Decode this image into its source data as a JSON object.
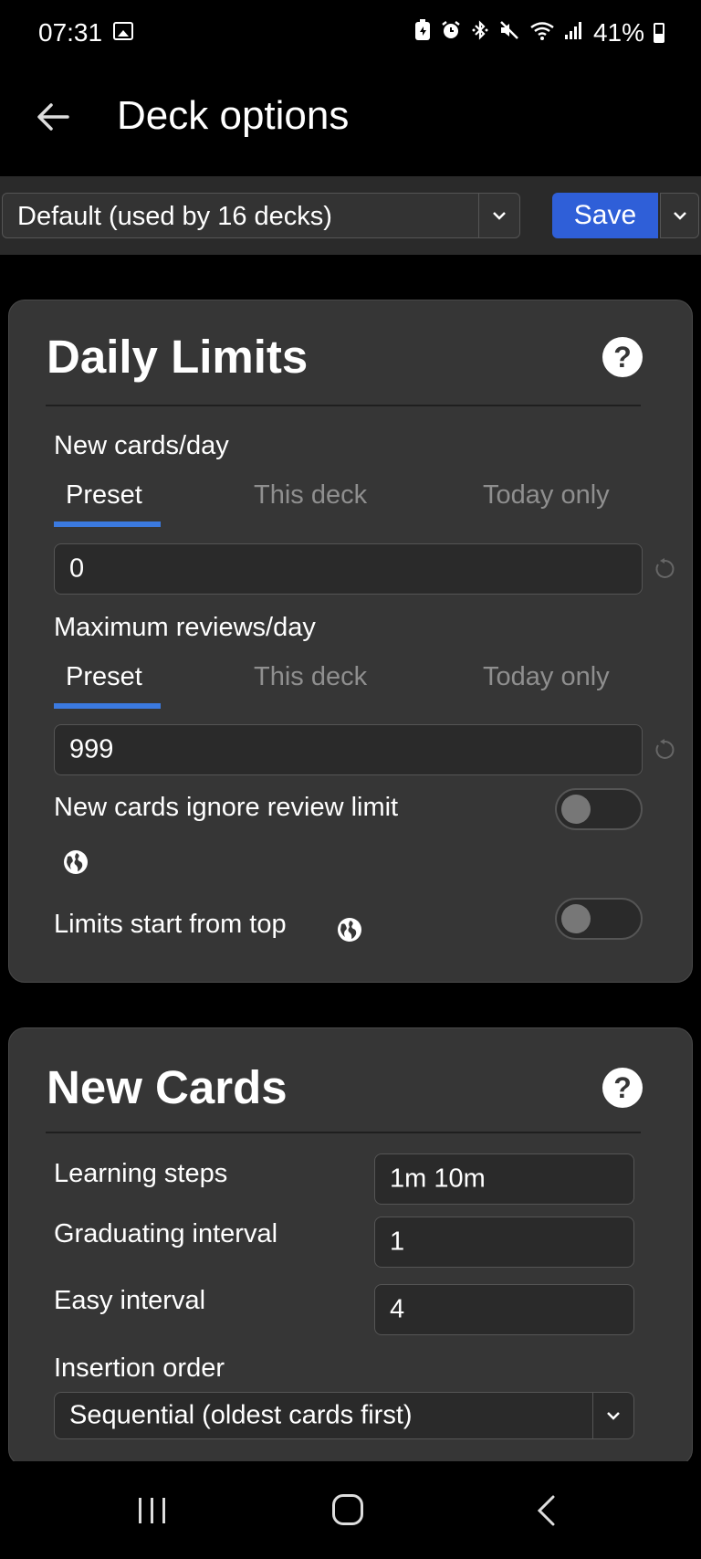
{
  "status": {
    "time": "07:31",
    "battery": "41%"
  },
  "header": {
    "title": "Deck options"
  },
  "toolbar": {
    "preset": "Default (used by 16 decks)",
    "save_label": "Save"
  },
  "daily_limits": {
    "title": "Daily Limits",
    "help": "?",
    "new_cards": {
      "label": "New cards/day",
      "tabs": [
        "Preset",
        "This deck",
        "Today only"
      ],
      "value": "0"
    },
    "max_reviews": {
      "label": "Maximum reviews/day",
      "tabs": [
        "Preset",
        "This deck",
        "Today only"
      ],
      "value": "999"
    },
    "ignore_review_limit": {
      "label": "New cards ignore review limit",
      "on": false
    },
    "limits_from_top": {
      "label": "Limits start from top",
      "on": false
    }
  },
  "new_cards": {
    "title": "New Cards",
    "help": "?",
    "learning_steps": {
      "label": "Learning steps",
      "value": "1m 10m"
    },
    "graduating_interval": {
      "label": "Graduating interval",
      "value": "1"
    },
    "easy_interval": {
      "label": "Easy interval",
      "value": "4"
    },
    "insertion_order": {
      "label": "Insertion order",
      "value": "Sequential (oldest cards first)"
    }
  },
  "colors": {
    "accent": "#3b7ae0",
    "save_button": "#2f5fd8",
    "card_bg": "#363636"
  }
}
